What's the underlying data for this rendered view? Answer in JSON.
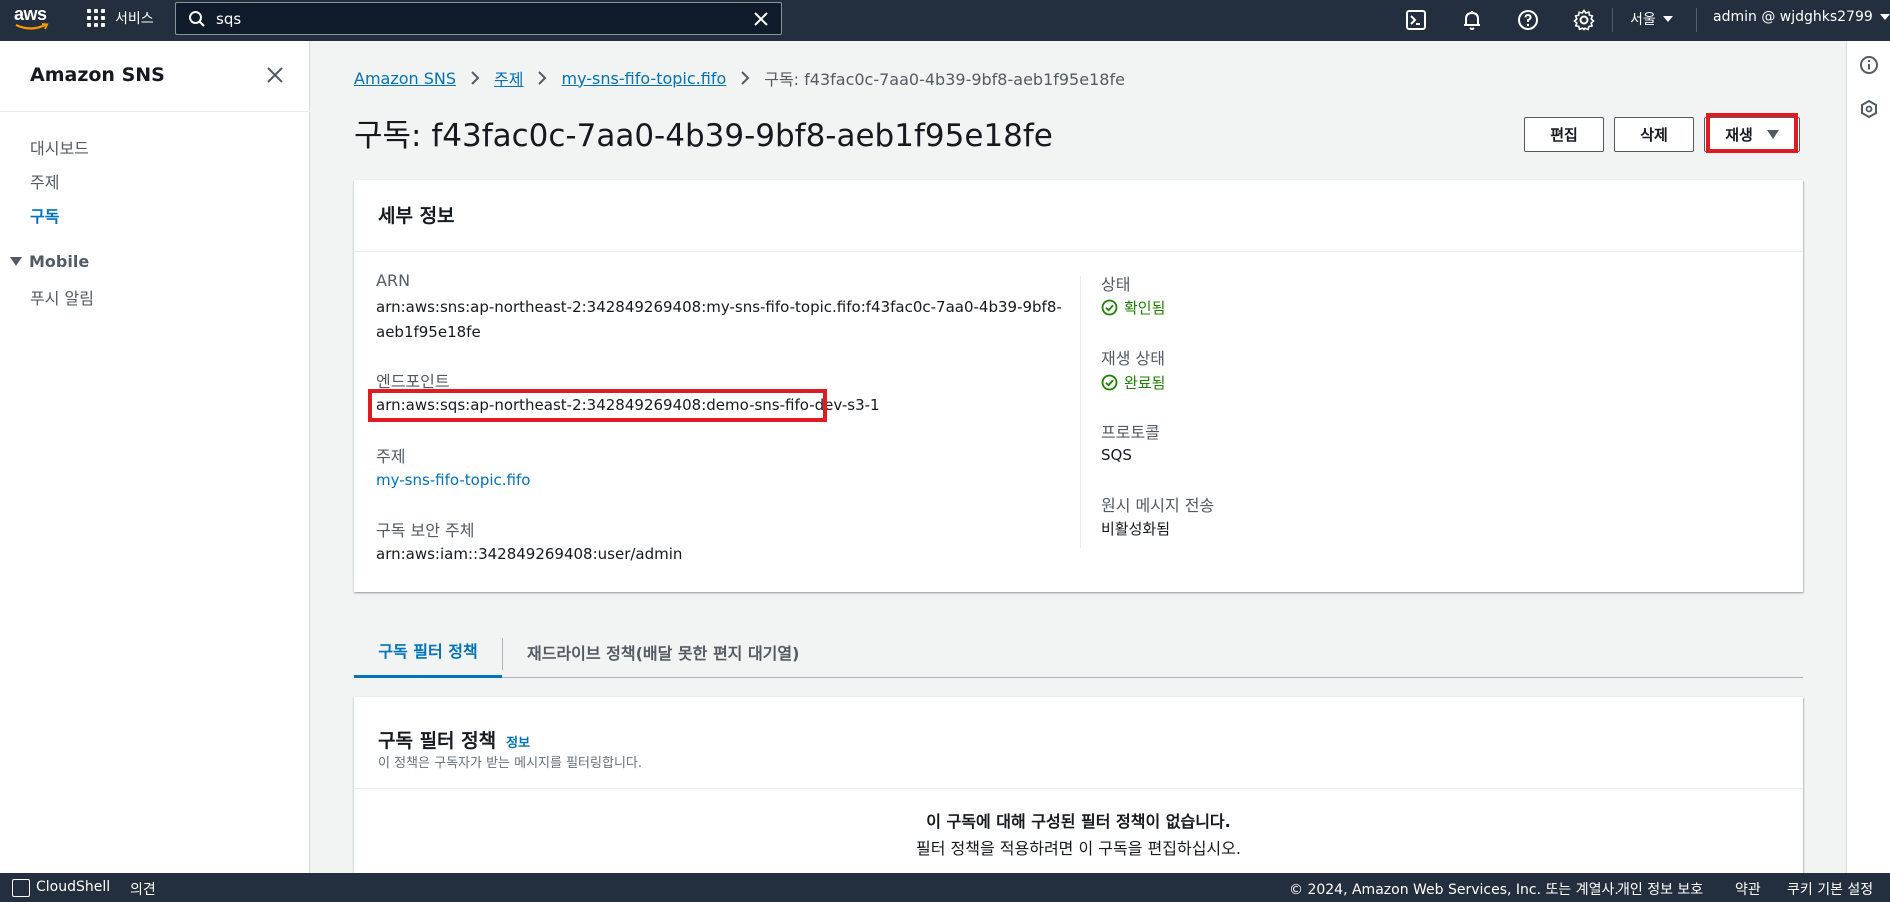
{
  "topnav": {
    "logo_text": "aws",
    "services_label": "서비스",
    "search_value": "sqs",
    "region_label": "서울",
    "account_label": "admin @ wjdghks2799"
  },
  "sidebar": {
    "title": "Amazon SNS",
    "items": [
      {
        "label": "대시보드"
      },
      {
        "label": "주제"
      },
      {
        "label": "구독"
      }
    ],
    "section": {
      "label": "Mobile",
      "items": [
        {
          "label": "푸시 알림"
        }
      ]
    }
  },
  "breadcrumb": {
    "items": [
      {
        "label": "Amazon SNS"
      },
      {
        "label": "주제"
      },
      {
        "label": "my-sns-fifo-topic.fifo"
      }
    ],
    "current": "구독: f43fac0c-7aa0-4b39-9bf8-aeb1f95e18fe"
  },
  "page": {
    "title": "구독: f43fac0c-7aa0-4b39-9bf8-aeb1f95e18fe",
    "edit_label": "편집",
    "delete_label": "삭제",
    "replay_label": "재생"
  },
  "details": {
    "title": "세부 정보",
    "arn_label": "ARN",
    "arn_line1": "arn:aws:sns:ap-northeast-2:342849269408:my-sns-fifo-topic.fifo:f43fac0c-7aa0-4b39-9bf8-",
    "arn_line2": "aeb1f95e18fe",
    "endpoint_label": "엔드포인트",
    "endpoint_value": "arn:aws:sqs:ap-northeast-2:342849269408:demo-sns-fifo-dev-s3-1",
    "topic_label": "주제",
    "topic_value": "my-sns-fifo-topic.fifo",
    "principal_label": "구독 보안 주체",
    "principal_value": "arn:aws:iam::342849269408:user/admin",
    "status_label": "상태",
    "status_value": "확인됨",
    "replay_status_label": "재생 상태",
    "replay_status_value": "완료됨",
    "protocol_label": "프로토콜",
    "protocol_value": "SQS",
    "raw_delivery_label": "원시 메시지 전송",
    "raw_delivery_value": "비활성화됨"
  },
  "tabs": [
    {
      "label": "구독 필터 정책"
    },
    {
      "label": "재드라이브 정책(배달 못한 편지 대기열)"
    }
  ],
  "filter_policy": {
    "title": "구독 필터 정책",
    "info_label": "정보",
    "description": "이 정책은 구독자가 받는 메시지를 필터링합니다.",
    "empty_title": "이 구독에 대해 구성된 필터 정책이 없습니다.",
    "empty_desc": "필터 정책을 적용하려면 이 구독을 편집하십시오."
  },
  "footer": {
    "cloudshell": "CloudShell",
    "feedback": "의견",
    "copyright": "© 2024, Amazon Web Services, Inc. 또는 계열사.",
    "privacy": "개인 정보 보호",
    "terms": "약관",
    "cookies": "쿠키 기본 설정"
  },
  "colors": {
    "nav_bg": "#232f3e",
    "link": "#0073bb",
    "success": "#1d8102",
    "highlight": "#e11b22"
  }
}
